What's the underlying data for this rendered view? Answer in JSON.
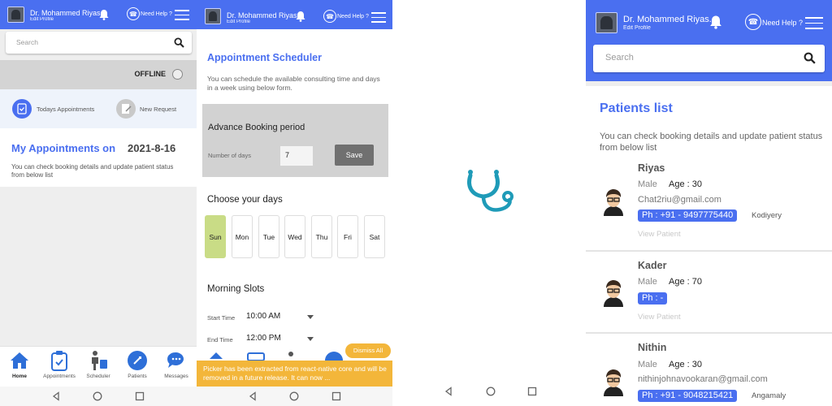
{
  "header": {
    "doctor_name": "Dr. Mohammed Riyas...",
    "edit_profile": "Edit Profile",
    "need_help": "Need Help ?"
  },
  "home": {
    "search_placeholder": "Search",
    "status": "OFFLINE",
    "quick_actions": [
      "Todays Appointments",
      "New Request"
    ],
    "appointments_title": "My Appointments  on",
    "appointments_date": "2021-8-16",
    "appointments_desc": "You can check booking details and update patient status from below list",
    "nav": [
      {
        "label": "Home",
        "icon": "home-icon"
      },
      {
        "label": "Appointments",
        "icon": "clipboard-icon"
      },
      {
        "label": "Scheduler",
        "icon": "scheduler-icon"
      },
      {
        "label": "Patients",
        "icon": "patients-icon"
      },
      {
        "label": "Messages",
        "icon": "chat-icon"
      }
    ]
  },
  "scheduler": {
    "title": "Appointment Scheduler",
    "desc": "You can schedule the available consulting time and days in a week using below form.",
    "advance_title": "Advance Booking period",
    "days_label": "Number of days",
    "days_value": "7",
    "save": "Save",
    "choose_days": "Choose your days",
    "days": [
      "Sun",
      "Mon",
      "Tue",
      "Wed",
      "Thu",
      "Fri",
      "Sat"
    ],
    "selected_day": "Sun",
    "morning_slots": "Morning Slots",
    "start_label": "Start Time",
    "start_value": "10:00 AM",
    "end_label": "End Time",
    "end_value": "12:00 PM",
    "dismiss_all": "Dismiss All",
    "warning": "Picker has been extracted from react-native core and will be removed in a future release. It can now ..."
  },
  "splash": {
    "icon": "stethoscope-icon",
    "color": "#1f9bb8"
  },
  "patients": {
    "search_placeholder": "Search",
    "title": "Patients list",
    "desc": "You can check booking details and update patient status from below list",
    "view_label": "View Patient",
    "items": [
      {
        "name": "Riyas",
        "gender": "Male",
        "age": "Age : 30",
        "email": "Chat2riu@gmail.com",
        "phone": "Ph : +91 - 9497775440",
        "place": "Kodiyery"
      },
      {
        "name": "Kader",
        "gender": "Male",
        "age": "Age : 70",
        "email": "",
        "phone": "Ph :  -",
        "place": ""
      },
      {
        "name": "Nithin",
        "gender": "Male",
        "age": "Age : 30",
        "email": "nithinjohnavookaran@gmail.com",
        "phone": "Ph : +91 - 9048215421",
        "place": "Angamaly"
      }
    ]
  },
  "colors": {
    "accent": "#4a6ff0",
    "warning": "#f3b63a",
    "selected_day": "#c9dc86"
  }
}
